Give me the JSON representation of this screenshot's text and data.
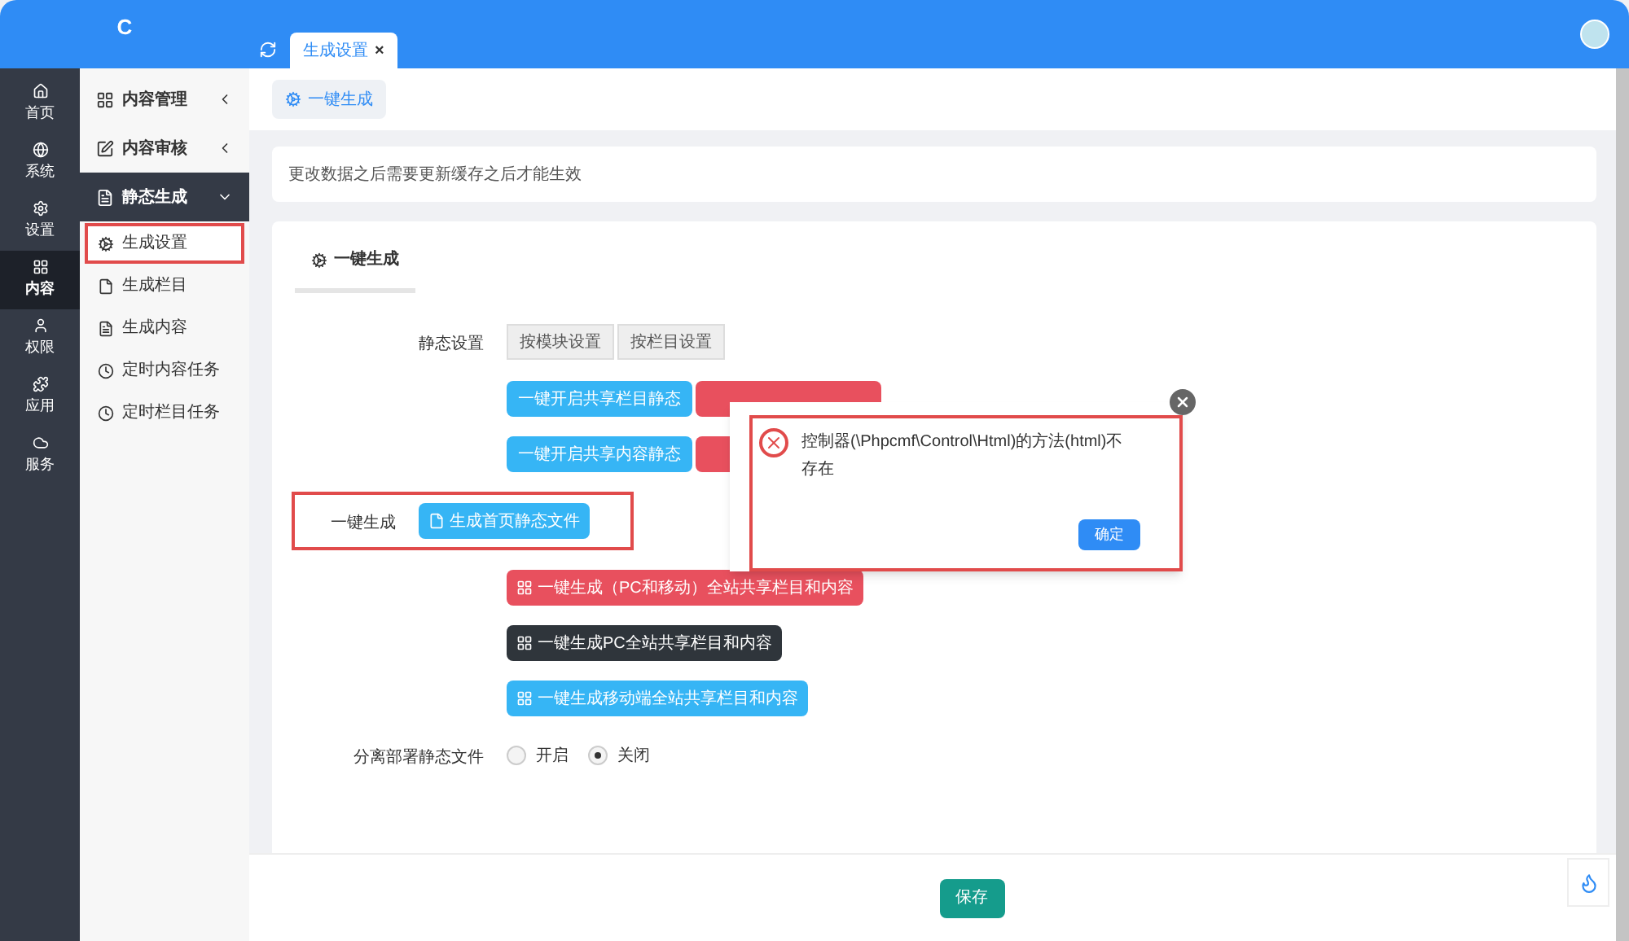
{
  "header": {
    "logo": "C",
    "tabs": [
      {
        "label": "生成设置",
        "selected": true,
        "close": "×"
      }
    ]
  },
  "rail": [
    {
      "label": "首页",
      "selected": false
    },
    {
      "label": "系统",
      "selected": false
    },
    {
      "label": "设置",
      "selected": false
    },
    {
      "label": "内容",
      "selected": true
    },
    {
      "label": "权限",
      "selected": false
    },
    {
      "label": "应用",
      "selected": false
    },
    {
      "label": "服务",
      "selected": false
    }
  ],
  "sidebar": [
    {
      "label": "内容管理",
      "expanded": false
    },
    {
      "label": "内容审核",
      "expanded": false
    },
    {
      "label": "静态生成",
      "expanded": true,
      "children": [
        {
          "label": "生成设置",
          "selected": true,
          "highlighted": true
        },
        {
          "label": "生成栏目",
          "selected": false,
          "highlighted": false
        },
        {
          "label": "生成内容",
          "selected": false,
          "highlighted": false
        },
        {
          "label": "定时内容任务",
          "selected": false,
          "highlighted": false
        },
        {
          "label": "定时栏目任务",
          "selected": false,
          "highlighted": false
        }
      ]
    }
  ],
  "page_tab": "一键生成",
  "notice": "更改数据之后需要更新缓存之后才能生效",
  "panel_title": "一键生成",
  "static_settings": {
    "label": "静态设置",
    "buttons": [
      "按模块设置",
      "按栏目设置"
    ]
  },
  "static_rows": [
    {
      "buttons": [
        {
          "text": "一键开启共享栏目静态",
          "color": "#36b5f5"
        },
        {
          "color": "#e8505e"
        }
      ]
    },
    {
      "buttons": [
        {
          "text": "一键开启共享内容静态",
          "color": "#36b5f5"
        },
        {
          "color": "#e8505e"
        }
      ]
    }
  ],
  "generate": {
    "label": "一键生成",
    "highlighted": true,
    "buttons": [
      {
        "text": "生成首页静态文件",
        "color": "#36b5f5"
      },
      {
        "text": "一键生成（PC和移动）全站共享栏目和内容",
        "color": "#e8505e"
      },
      {
        "text": "一键生成PC全站共享栏目和内容",
        "color": "#2f353b"
      },
      {
        "text": "一键生成移动端全站共享栏目和内容",
        "color": "#36b5f5"
      }
    ]
  },
  "deploy": {
    "label": "分离部署静态文件",
    "options": [
      {
        "label": "开启",
        "selected": false
      },
      {
        "label": "关闭",
        "selected": true
      }
    ]
  },
  "save": "保存",
  "dialog": {
    "message": "控制器(\\Phpcmf\\Control\\Html)的方法(html)不存在",
    "ok": "确定",
    "highlighted": true
  }
}
